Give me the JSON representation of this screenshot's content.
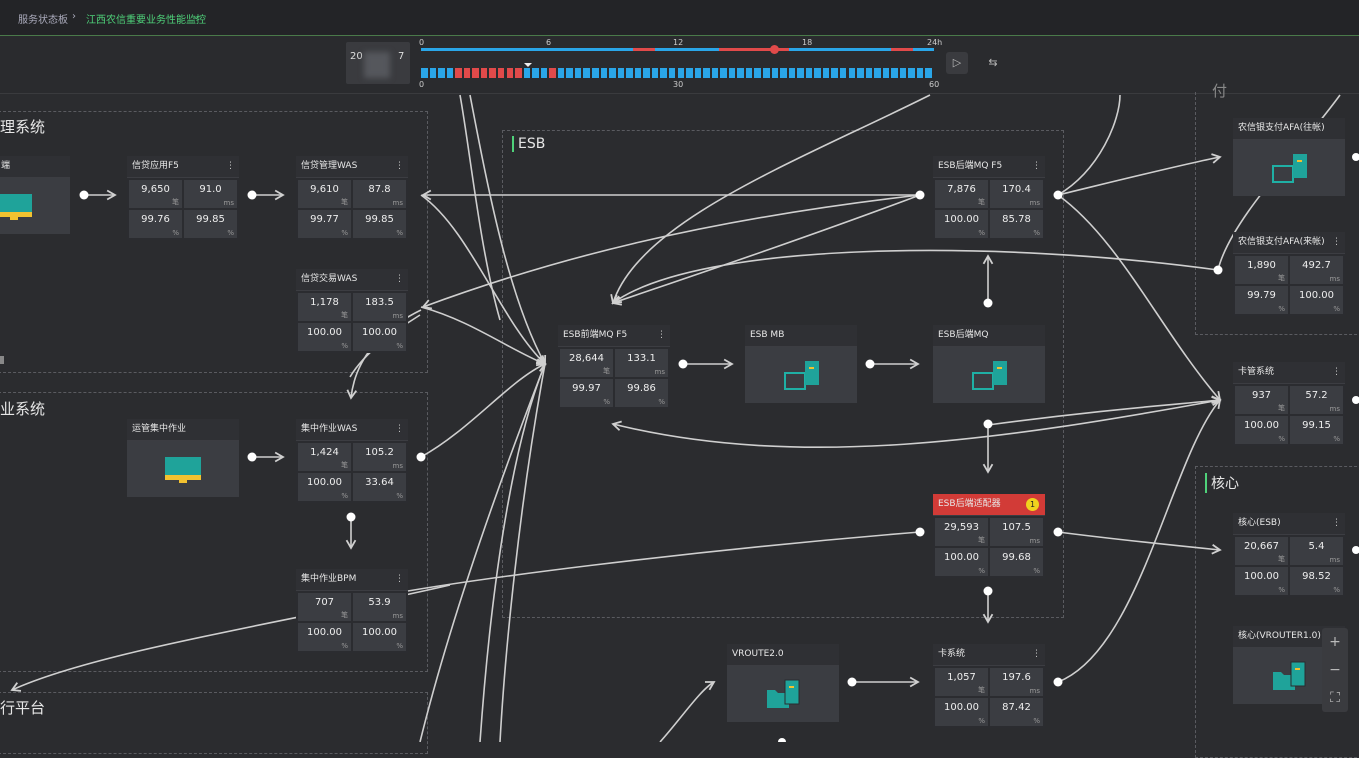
{
  "breadcrumb": {
    "root": "服务状态板",
    "current": "江西农信重要业务性能监控"
  },
  "timeline": {
    "date_visible": "20",
    "date_tail": "7",
    "hour_ticks": [
      "0",
      "6",
      "12",
      "18",
      "24h"
    ],
    "minute_ticks": [
      "0",
      "30",
      "60"
    ],
    "status_colors": {
      "ok": "#2aa6e8",
      "alert": "#e14a4a"
    }
  },
  "groups": {
    "credit": "理系统",
    "ops": "业系统",
    "platform": "行平台",
    "esb": "ESB",
    "core": "核心",
    "pay": "付"
  },
  "cards": {
    "c_left": {
      "title": "端"
    },
    "c_f5": {
      "title": "信贷应用F5",
      "a": "9,650",
      "au": "笔",
      "b": "91.0",
      "bu": "ms",
      "c": "99.76",
      "cu": "%",
      "d": "99.85",
      "du": "%"
    },
    "c_was": {
      "title": "信贷管理WAS",
      "a": "9,610",
      "au": "笔",
      "b": "87.8",
      "bu": "ms",
      "c": "99.77",
      "cu": "%",
      "d": "99.85",
      "du": "%"
    },
    "c_trade": {
      "title": "信贷交易WAS",
      "a": "1,178",
      "au": "笔",
      "b": "183.5",
      "bu": "ms",
      "c": "100.00",
      "cu": "%",
      "d": "100.00",
      "du": "%"
    },
    "c_ops": {
      "title": "运管集中作业"
    },
    "c_cwas": {
      "title": "集中作业WAS",
      "a": "1,424",
      "au": "笔",
      "b": "105.2",
      "bu": "ms",
      "c": "100.00",
      "cu": "%",
      "d": "33.64",
      "du": "%"
    },
    "c_bpm": {
      "title": "集中作业BPM",
      "a": "707",
      "au": "笔",
      "b": "53.9",
      "bu": "ms",
      "c": "100.00",
      "cu": "%",
      "d": "100.00",
      "du": "%"
    },
    "c_esbfront": {
      "title": "ESB前端MQ F5",
      "a": "28,644",
      "au": "笔",
      "b": "133.1",
      "bu": "ms",
      "c": "99.97",
      "cu": "%",
      "d": "99.86",
      "du": "%"
    },
    "c_esbmb": {
      "title": "ESB MB"
    },
    "c_esbback": {
      "title": "ESB后端MQ"
    },
    "c_esbbackf5": {
      "title": "ESB后端MQ F5",
      "a": "7,876",
      "au": "笔",
      "b": "170.4",
      "bu": "ms",
      "c": "100.00",
      "cu": "%",
      "d": "85.78",
      "du": "%"
    },
    "c_adapter": {
      "title": "ESB后端适配器",
      "badge": "1",
      "a": "29,593",
      "au": "笔",
      "b": "107.5",
      "bu": "ms",
      "c": "100.00",
      "cu": "%",
      "d": "99.68",
      "du": "%"
    },
    "c_vroute": {
      "title": "VROUTE2.0"
    },
    "c_card": {
      "title": "卡系统",
      "a": "1,057",
      "au": "笔",
      "b": "197.6",
      "bu": "ms",
      "c": "100.00",
      "cu": "%",
      "d": "87.42",
      "du": "%"
    },
    "c_afa_out": {
      "title": "农信银支付AFA(往帐)"
    },
    "c_afa_in": {
      "title": "农信银支付AFA(来帐)",
      "a": "1,890",
      "au": "笔",
      "b": "492.7",
      "bu": "ms",
      "c": "99.79",
      "cu": "%",
      "d": "100.00",
      "du": "%"
    },
    "c_cardmgmt": {
      "title": "卡管系统",
      "a": "937",
      "au": "笔",
      "b": "57.2",
      "bu": "ms",
      "c": "100.00",
      "cu": "%",
      "d": "99.15",
      "du": "%"
    },
    "c_core": {
      "title": "核心(ESB)",
      "a": "20,667",
      "au": "笔",
      "b": "5.4",
      "bu": "ms",
      "c": "100.00",
      "cu": "%",
      "d": "98.52",
      "du": "%"
    },
    "c_vrouter": {
      "title": "核心(VROUTER1.0)"
    }
  },
  "menu_glyph": "⋮",
  "controls": {
    "play": "▷",
    "swap": "⇆",
    "zoom_in": "+",
    "zoom_out": "−",
    "fit": "⛶"
  }
}
